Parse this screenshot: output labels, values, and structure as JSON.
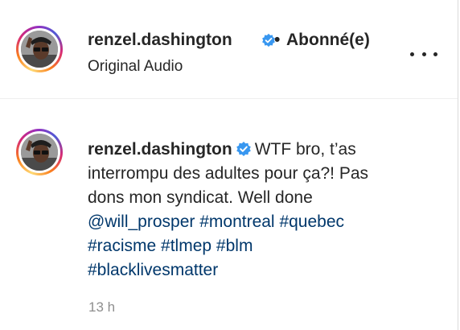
{
  "header": {
    "username": "renzel.dashington",
    "separator": "•",
    "follow_state": "Abonné(e)",
    "audio_label": "Original Audio"
  },
  "comment": {
    "username": "renzel.dashington",
    "lines": [
      "WTF bro, t’as",
      "interrompu des adultes pour ça?! Pas",
      "dons mon syndicat. Well done"
    ],
    "hashtags": {
      "mention": "@will_prosper",
      "tag1": "#montreal",
      "tag2": "#quebec",
      "tag3": "#racisme",
      "tag4": "#tlmep",
      "tag5": "#blm",
      "tag6": "#blacklivesmatter"
    },
    "timestamp": "13 h"
  },
  "icons": {
    "verified": "verified-badge-icon",
    "more": "more-options-icon"
  },
  "colors": {
    "verified_blue": "#3897f0",
    "link": "#00376b",
    "meta_gray": "#8e8e8e"
  }
}
